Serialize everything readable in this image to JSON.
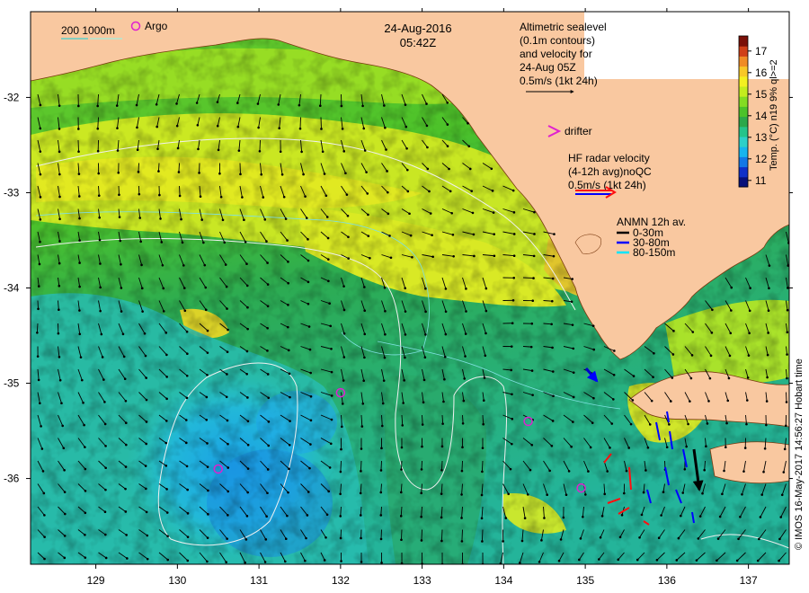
{
  "map": {
    "date": "24-Aug-2016",
    "time": "05:42Z",
    "lon_ticks": [
      "129",
      "130",
      "131",
      "132",
      "133",
      "134",
      "135",
      "136",
      "137"
    ],
    "lat_ticks": [
      "-32",
      "-33",
      "-34",
      "-35",
      "-36"
    ],
    "lon_values": [
      129,
      130,
      131,
      132,
      133,
      134,
      135,
      136,
      137
    ],
    "lat_values": [
      -32,
      -33,
      -34,
      -35,
      -36
    ],
    "lon_range": [
      128.2,
      137.5
    ],
    "lat_range": [
      -36.9,
      -31.1
    ],
    "argo_positions": [
      [
        130.5,
        -35.9
      ],
      [
        132.0,
        -35.1
      ],
      [
        134.3,
        -35.4
      ],
      [
        134.95,
        -36.1
      ]
    ],
    "credit": "© IMOS 16-May-2017 14:56:27 Hobart time"
  },
  "legend": {
    "depth_label": "200  1000m",
    "argo_label": "Argo",
    "altimetry_lines": [
      "Altimetric sealevel",
      "(0.1m contours)",
      "and velocity for",
      "24-Aug 05Z",
      "0.5m/s (1kt 24h)"
    ],
    "drifter_label": "drifter",
    "hf_radar_lines": [
      "HF radar velocity",
      "(4-12h avg)noQC",
      "0.5m/s (1kt 24h)"
    ],
    "anmn_title": "ANMN 12h av.",
    "anmn_items": [
      {
        "label": "0-30m",
        "color": "#000000"
      },
      {
        "label": "30-80m",
        "color": "#0000ff"
      },
      {
        "label": "80-150m",
        "color": "#00e5ff"
      }
    ]
  },
  "colorbar": {
    "ticks": [
      "11",
      "12",
      "13",
      "14",
      "15",
      "16",
      "17"
    ],
    "tick_values": [
      11,
      12,
      13,
      14,
      15,
      16,
      17
    ],
    "range": [
      10.7,
      17.7
    ],
    "label": "Temp. (°C) n19 9% ql>=2",
    "colors": [
      "#08107a",
      "#1030c8",
      "#1478e6",
      "#18b4ee",
      "#2ed0c8",
      "#26c48a",
      "#2ca84a",
      "#4cc22a",
      "#84dc22",
      "#c4ec1e",
      "#f4f020",
      "#f8c828",
      "#f08c26",
      "#d04018",
      "#7a1008"
    ]
  },
  "colors": {
    "land": "#f9c8a0",
    "argo": "#e020d0",
    "contour": "#f0f0f0",
    "hf_red": "#ff1010",
    "hf_blue": "#0000ff"
  }
}
